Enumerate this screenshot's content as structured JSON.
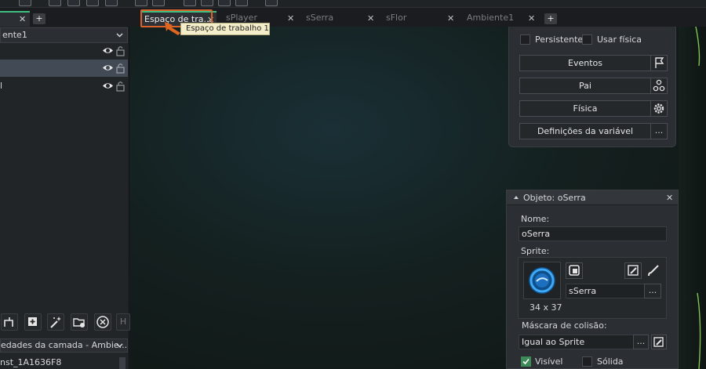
{
  "left_panel": {
    "tab_label": "",
    "room_select": "ente1",
    "layers": [
      {
        "label": ""
      },
      {
        "label": ""
      },
      {
        "label": "l"
      }
    ],
    "props_header": "edades da camada - Ambie...",
    "instance_row": "nst_1A1636F8",
    "tool_h_label": "H"
  },
  "workspace": {
    "tabs": [
      {
        "label": "Espaço de tra...",
        "active": true
      },
      {
        "label": "sPlayer",
        "active": false
      },
      {
        "label": "sSerra",
        "active": false
      },
      {
        "label": "sFlor",
        "active": false
      },
      {
        "label": "Ambiente1",
        "active": false
      }
    ],
    "add_tab": "+",
    "tooltip": "Espaço de trabalho 1",
    "accent_color": "#3fbf7f",
    "highlight_color": "#d9632a"
  },
  "object_properties": {
    "persistent_label": "Persistente",
    "physics_label": "Usar física",
    "events_label": "Eventos",
    "parent_label": "Pai",
    "physics_button_label": "Física",
    "variables_label": "Definições da variável",
    "more_label": "..."
  },
  "object_editor": {
    "title": "Objeto: oSerra",
    "name_label": "Nome:",
    "name_value": "oSerra",
    "sprite_label": "Sprite:",
    "sprite_name": "sSerra",
    "sprite_size": "34 x 37",
    "more_label": "...",
    "collision_mask_label": "Máscara de colisão:",
    "collision_mask_value": "Igual ao Sprite",
    "visible_label": "Visível",
    "visible_checked": true,
    "solid_label": "Sólida",
    "solid_checked": false
  }
}
